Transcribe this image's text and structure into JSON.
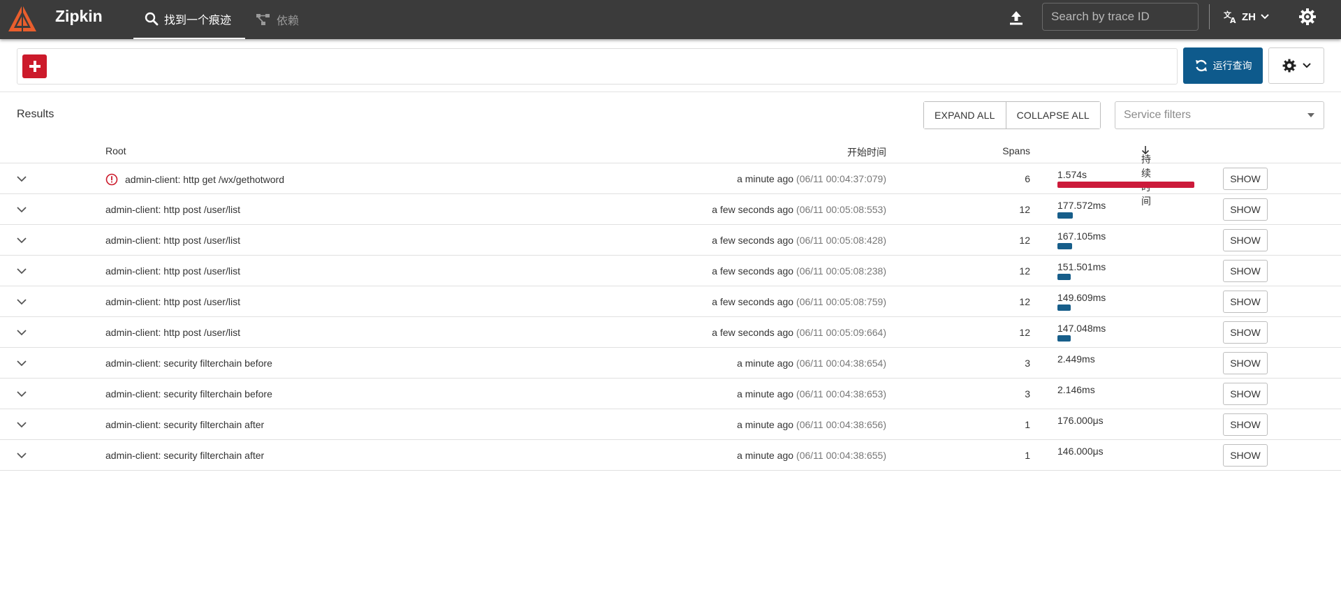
{
  "header": {
    "brand": "Zipkin",
    "tabs": [
      {
        "label": "找到一个痕迹",
        "icon": "search-icon",
        "active": true
      },
      {
        "label": "依赖",
        "icon": "dependencies-icon",
        "active": false
      }
    ],
    "search": {
      "placeholder": "Search by trace ID",
      "value": ""
    },
    "language": "ZH"
  },
  "query": {
    "run_label": "运行查询"
  },
  "results": {
    "title": "Results",
    "expand_all_label": "EXPAND ALL",
    "collapse_all_label": "COLLAPSE ALL",
    "service_filter_placeholder": "Service filters",
    "columns": {
      "root": "Root",
      "start": "开始时间",
      "spans": "Spans",
      "duration": "持续时间"
    },
    "show_label": "SHOW",
    "rows": [
      {
        "root": "admin-client: http get /wx/gethotword",
        "error": true,
        "relative": "a minute ago",
        "timestamp": "(06/11 00:04:37:079)",
        "spans": "6",
        "duration": "1.574s",
        "duration_fraction": 1.0
      },
      {
        "root": "admin-client: http post /user/list",
        "error": false,
        "relative": "a few seconds ago",
        "timestamp": "(06/11 00:05:08:553)",
        "spans": "12",
        "duration": "177.572ms",
        "duration_fraction": 0.113
      },
      {
        "root": "admin-client: http post /user/list",
        "error": false,
        "relative": "a few seconds ago",
        "timestamp": "(06/11 00:05:08:428)",
        "spans": "12",
        "duration": "167.105ms",
        "duration_fraction": 0.106
      },
      {
        "root": "admin-client: http post /user/list",
        "error": false,
        "relative": "a few seconds ago",
        "timestamp": "(06/11 00:05:08:238)",
        "spans": "12",
        "duration": "151.501ms",
        "duration_fraction": 0.096
      },
      {
        "root": "admin-client: http post /user/list",
        "error": false,
        "relative": "a few seconds ago",
        "timestamp": "(06/11 00:05:08:759)",
        "spans": "12",
        "duration": "149.609ms",
        "duration_fraction": 0.095
      },
      {
        "root": "admin-client: http post /user/list",
        "error": false,
        "relative": "a few seconds ago",
        "timestamp": "(06/11 00:05:09:664)",
        "spans": "12",
        "duration": "147.048ms",
        "duration_fraction": 0.093
      },
      {
        "root": "admin-client: security filterchain before",
        "error": false,
        "relative": "a minute ago",
        "timestamp": "(06/11 00:04:38:654)",
        "spans": "3",
        "duration": "2.449ms",
        "duration_fraction": 0.0016
      },
      {
        "root": "admin-client: security filterchain before",
        "error": false,
        "relative": "a minute ago",
        "timestamp": "(06/11 00:04:38:653)",
        "spans": "3",
        "duration": "2.146ms",
        "duration_fraction": 0.0014
      },
      {
        "root": "admin-client: security filterchain after",
        "error": false,
        "relative": "a minute ago",
        "timestamp": "(06/11 00:04:38:656)",
        "spans": "1",
        "duration": "176.000μs",
        "duration_fraction": 0.0001
      },
      {
        "root": "admin-client: security filterchain after",
        "error": false,
        "relative": "a minute ago",
        "timestamp": "(06/11 00:04:38:655)",
        "spans": "1",
        "duration": "146.000μs",
        "duration_fraction": 0.0001
      }
    ]
  },
  "colors": {
    "header_bg": "#3b3b3b",
    "accent_red": "#cc1a2b",
    "run_query_blue": "#0e5a8c",
    "duration_bar": "#175e8a",
    "error_bar": "#cc1a3a"
  }
}
